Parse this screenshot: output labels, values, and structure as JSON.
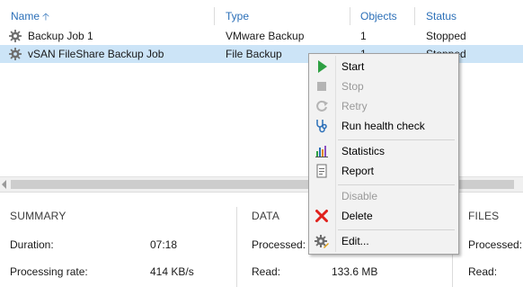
{
  "columns": {
    "name": "Name",
    "type": "Type",
    "objects": "Objects",
    "status": "Status"
  },
  "jobs": [
    {
      "name": "Backup Job 1",
      "type": "VMware Backup",
      "objects": "1",
      "status": "Stopped",
      "selected": false
    },
    {
      "name": "vSAN FileShare Backup Job",
      "type": "File Backup",
      "objects": "1",
      "status": "Stopped",
      "selected": true
    }
  ],
  "summary": {
    "sections": {
      "summary": "SUMMARY",
      "data": "DATA",
      "files": "FILES"
    },
    "duration_label": "Duration:",
    "duration_value": "07:18",
    "processing_rate_label": "Processing rate:",
    "processing_rate_value": "414 KB/s",
    "data_processed_label": "Processed:",
    "data_read_label": "Read:",
    "data_read_value": "133.6 MB",
    "files_processed_label": "Processed:",
    "files_read_label": "Read:"
  },
  "context_menu": {
    "items": [
      {
        "label": "Start",
        "icon": "play-icon",
        "enabled": true
      },
      {
        "label": "Stop",
        "icon": "stop-icon",
        "enabled": false
      },
      {
        "label": "Retry",
        "icon": "retry-icon",
        "enabled": false
      },
      {
        "label": "Run health check",
        "icon": "stethoscope-icon",
        "enabled": true
      },
      {
        "label": "Statistics",
        "icon": "statistics-icon",
        "enabled": true
      },
      {
        "label": "Report",
        "icon": "report-icon",
        "enabled": true
      },
      {
        "label": "Disable",
        "icon": "",
        "enabled": false
      },
      {
        "label": "Delete",
        "icon": "delete-x-icon",
        "enabled": true
      },
      {
        "label": "Edit...",
        "icon": "edit-gear-icon",
        "enabled": true
      }
    ]
  },
  "colors": {
    "header_text": "#2b6fb8",
    "selection": "#cce4f7",
    "play_green": "#2ea043",
    "delete_red": "#e0201b"
  }
}
